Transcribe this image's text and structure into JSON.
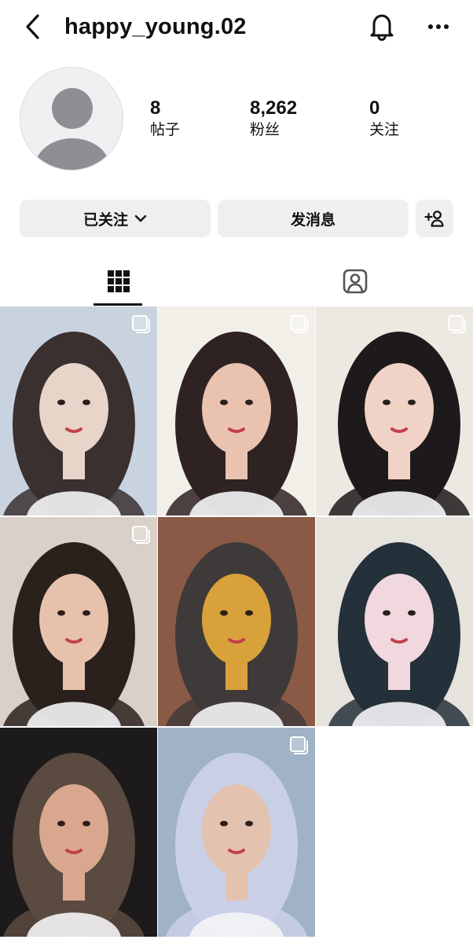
{
  "header": {
    "username": "happy_young.02",
    "back_icon": "chevron-left-icon",
    "bell_icon": "bell-icon",
    "more_icon": "more-horizontal-icon"
  },
  "profile": {
    "avatar": "default-avatar",
    "stats": [
      {
        "value": "8",
        "label": "帖子"
      },
      {
        "value": "8,262",
        "label": "粉丝"
      },
      {
        "value": "0",
        "label": "关注"
      }
    ]
  },
  "actions": {
    "following_label": "已关注",
    "message_label": "发消息",
    "add_user_icon": "add-user-icon"
  },
  "tabs": [
    {
      "name": "posts-grid",
      "icon": "grid-icon",
      "active": true
    },
    {
      "name": "tagged",
      "icon": "tagged-person-icon",
      "active": false
    }
  ],
  "posts": [
    {
      "index": 1,
      "multiple": true,
      "palette": [
        "#c9d3e0",
        "#e8d4c9",
        "#3a3030"
      ]
    },
    {
      "index": 2,
      "multiple": true,
      "palette": [
        "#f2efe9",
        "#e9c3b0",
        "#2f2222"
      ]
    },
    {
      "index": 3,
      "multiple": true,
      "palette": [
        "#ece8e2",
        "#f0d3c6",
        "#1e1a1b"
      ]
    },
    {
      "index": 4,
      "multiple": true,
      "palette": [
        "#d9d0c8",
        "#e6c2ad",
        "#2a211d"
      ]
    },
    {
      "index": 5,
      "multiple": false,
      "palette": [
        "#8a5a46",
        "#d9a13a",
        "#3f3a3a"
      ]
    },
    {
      "index": 6,
      "multiple": false,
      "palette": [
        "#e6e2dc",
        "#f1d8de",
        "#24303a"
      ]
    },
    {
      "index": 7,
      "multiple": false,
      "palette": [
        "#1c1a1b",
        "#d8a78e",
        "#5a4a40"
      ]
    },
    {
      "index": 8,
      "multiple": true,
      "palette": [
        "#9fb2c6",
        "#e3c2b0",
        "#c9d0e6"
      ]
    }
  ],
  "colors": {
    "button_bg": "#efeff2",
    "text": "#111111",
    "avatar_bg": "#f0f0f2",
    "avatar_figure": "#8e8e93"
  }
}
